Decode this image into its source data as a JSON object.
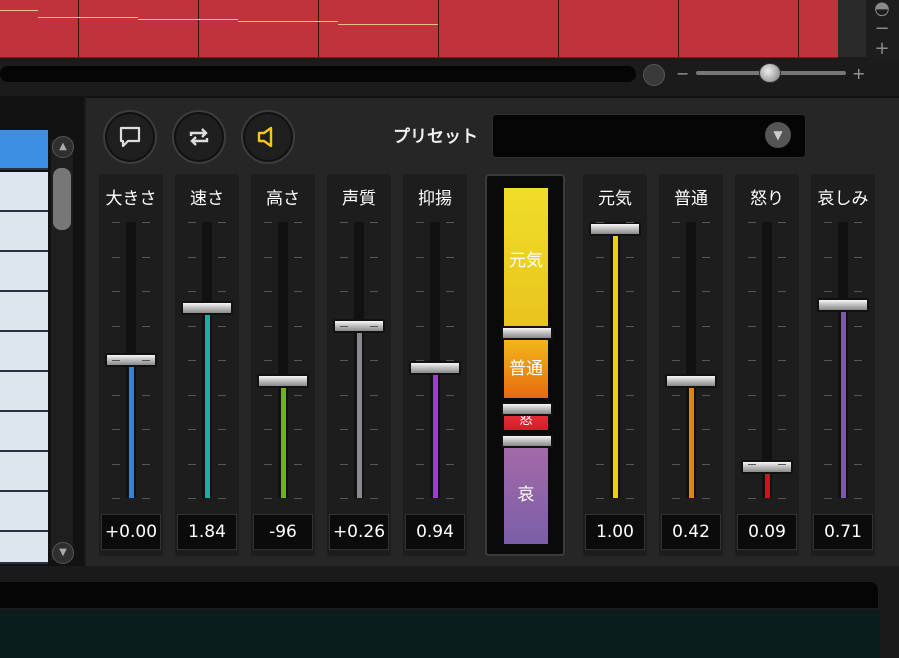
{
  "toolbar": {
    "icons": [
      "speech-bubble-icon",
      "loop-icon",
      "speaker-icon"
    ]
  },
  "preset": {
    "label": "プリセット",
    "value": ""
  },
  "sliders": [
    {
      "label": "大きさ",
      "value": "+0.00",
      "level": 0.5,
      "color": "#2a84e0"
    },
    {
      "label": "速さ",
      "value": "1.84",
      "level": 0.7,
      "color": "#14b0a4"
    },
    {
      "label": "高さ",
      "value": "-96",
      "level": 0.42,
      "color": "#6cb317"
    },
    {
      "label": "声質",
      "value": "+0.26",
      "level": 0.63,
      "color": "#888a90"
    },
    {
      "label": "抑揚",
      "value": "0.94",
      "level": 0.47,
      "color": "#9a3de0"
    }
  ],
  "emotion_stack": {
    "segments": [
      {
        "label": "元気",
        "color_top": "#f0de2a",
        "color_bottom": "#e8c21c"
      },
      {
        "label": "普通",
        "color_top": "#f0b71a",
        "color_bottom": "#e86a0e"
      },
      {
        "label": "怒",
        "color_top": "#e8303a",
        "color_bottom": "#d41c28"
      },
      {
        "label": "哀",
        "color_top": "#a46aa8",
        "color_bottom": "#7a5fa8"
      }
    ]
  },
  "emotions": [
    {
      "label": "元気",
      "value": "1.00",
      "level": 1.0,
      "color": "#e8d20e"
    },
    {
      "label": "普通",
      "value": "0.42",
      "level": 0.42,
      "color": "#e8820e"
    },
    {
      "label": "怒り",
      "value": "0.09",
      "level": 0.09,
      "color": "#d11020"
    },
    {
      "label": "哀しみ",
      "value": "0.71",
      "level": 0.71,
      "color": "#7a5aa8"
    }
  ]
}
